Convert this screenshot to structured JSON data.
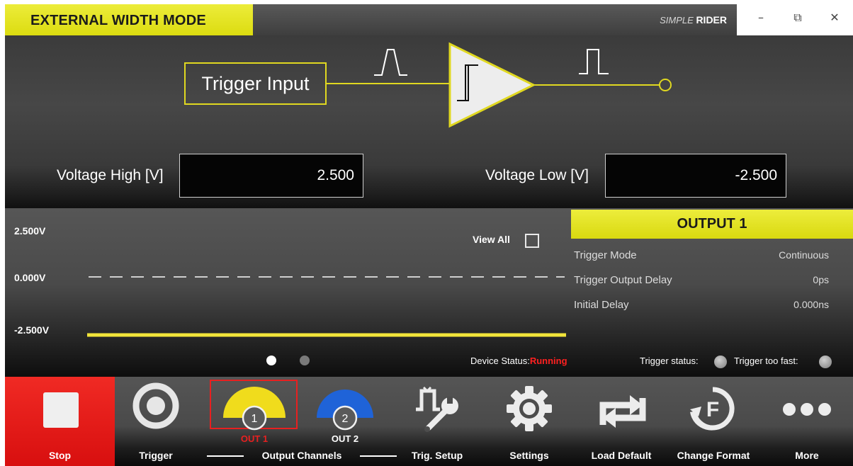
{
  "titlebar": {
    "mode_title": "EXTERNAL WIDTH MODE",
    "brand_simple": "SIMPLE",
    "brand_rider": "RIDER",
    "minimize": "–",
    "restore": "⧉",
    "close": "✕"
  },
  "diagram": {
    "trigger_input_label": "Trigger Input",
    "line_color": "#e0d820"
  },
  "voltage": {
    "high_label": "Voltage High [V]",
    "high_value": "2.500",
    "low_label": "Voltage Low [V]",
    "low_value": "-2.500"
  },
  "scope": {
    "y_top": "2.500V",
    "y_mid": "0.000V",
    "y_bottom": "-2.500V",
    "view_all_label": "View All",
    "view_all_checked": false,
    "page_count": 2,
    "active_page": 1
  },
  "output_panel": {
    "title": "OUTPUT 1",
    "rows": [
      {
        "label": "Trigger Mode",
        "value": "Continuous"
      },
      {
        "label": "Trigger Output Delay",
        "value": "0ps"
      },
      {
        "label": "Initial Delay",
        "value": "0.000ns"
      }
    ]
  },
  "status": {
    "device_label": "Device Status:",
    "device_value": "Running",
    "trigger_status_label": "Trigger status:",
    "trigger_fast_label": "Trigger too fast:"
  },
  "toolbar": {
    "stop": "Stop",
    "trigger": "Trigger",
    "out1": "OUT 1",
    "out1_num": "1",
    "out2": "OUT 2",
    "out2_num": "2",
    "output_channels": "Output Channels",
    "trig_setup": "Trig. Setup",
    "settings": "Settings",
    "load_default": "Load Default",
    "change_format": "Change Format",
    "more": "More"
  },
  "colors": {
    "accent_yellow": "#e0d820",
    "stop_red": "#e61b18",
    "out2_blue": "#1f63d8",
    "status_red": "#ff2020"
  }
}
